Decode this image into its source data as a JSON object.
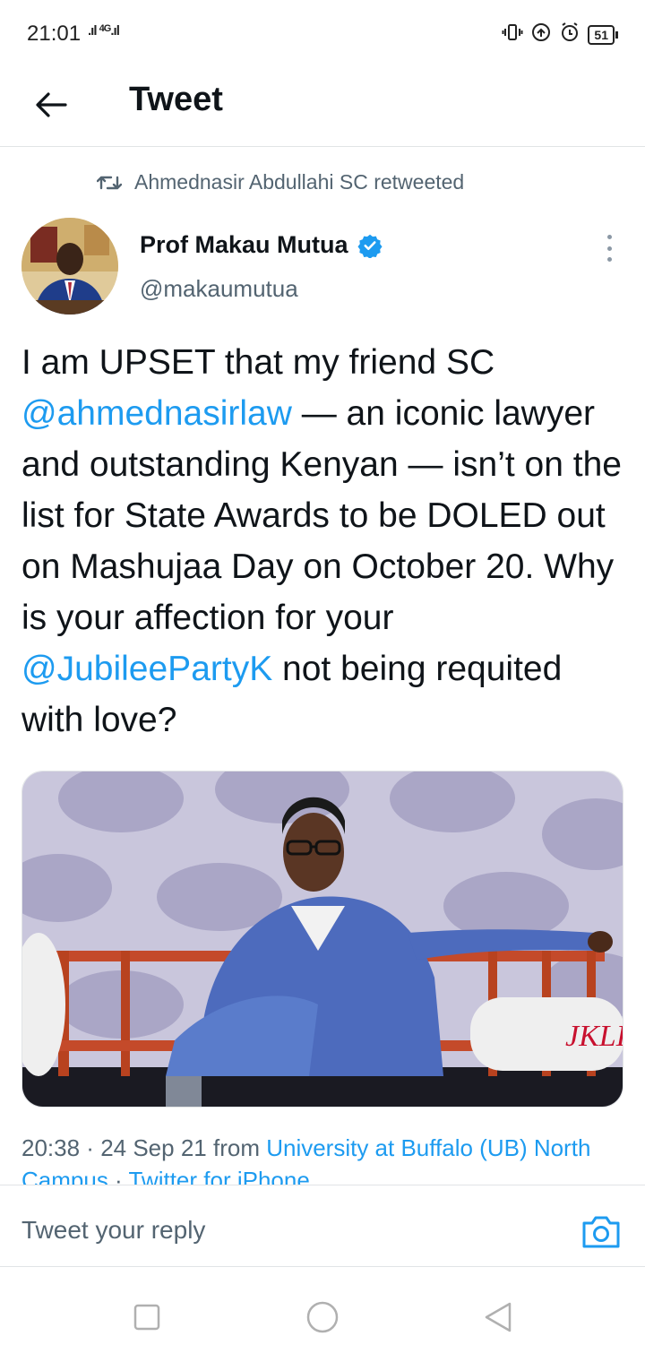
{
  "status_bar": {
    "time": "21:01",
    "network": "4G",
    "battery": "51",
    "icons": [
      "signal-icon",
      "vibrate-icon",
      "data-saver-icon",
      "alarm-icon",
      "battery-icon"
    ]
  },
  "header": {
    "title": "Tweet"
  },
  "retweet": {
    "text": "Ahmednasir Abdullahi SC retweeted"
  },
  "author": {
    "name": "Prof Makau Mutua",
    "handle": "@makaumutua",
    "verified": true
  },
  "tweet": {
    "text_1": "I am UPSET that my friend SC ",
    "mention_1": "@ahmednasirlaw",
    "text_2": " — an iconic lawyer and outstanding Kenyan — isn’t on the list for State Awards to be DOLED out on Mashujaa Day on October 20.  Why is your affection for your ",
    "mention_2": "@JubileePartyK",
    "text_3": " not being requited with love?",
    "image_caption": "JKLI"
  },
  "meta": {
    "time": "20:38",
    "sep1": " · ",
    "date": "24 Sep 21",
    "from": " from ",
    "location": "University at Buffalo (UB) North Campus",
    "sep2": " · ",
    "client": "Twitter for iPhone"
  },
  "reply": {
    "placeholder": "Tweet your reply"
  },
  "colors": {
    "accent": "#1d9bf0",
    "secondary_text": "#536471",
    "primary_text": "#0f1419"
  }
}
